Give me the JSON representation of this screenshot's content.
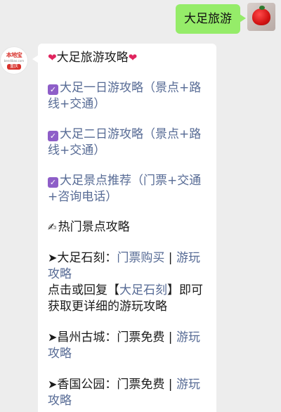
{
  "outgoing": {
    "text": "大足旅游"
  },
  "bot": {
    "brand": "本地宝",
    "site": "bendibao.com",
    "city": "重庆"
  },
  "message": {
    "title_heart_left": "❤",
    "title": "大足旅游攻略",
    "title_heart_right": "❤",
    "links": [
      {
        "check": "✓",
        "text": "大足一日游攻略（景点+路线+交通）"
      },
      {
        "check": "✓",
        "text": "大足二日游攻略（景点+路线+交通）"
      },
      {
        "check": "✓",
        "text": "大足景点推荐（门票+交通+咨询电话）"
      }
    ],
    "hot_icon": "✍",
    "hot_title": "热门景点攻略",
    "spots": [
      {
        "arrow": "➤",
        "name": "大足石刻：",
        "ticket": "门票购买",
        "sep": " | ",
        "guide": "游玩攻略",
        "note_pre": "点击或回复【",
        "note_key": "大足石刻",
        "note_post": "】即可获取更详细的游玩攻略"
      },
      {
        "arrow": "➤",
        "name": "昌州古城：",
        "ticket": "门票免费",
        "sep": " | ",
        "guide": "游玩攻略"
      },
      {
        "arrow": "➤",
        "name": "香国公园：",
        "ticket": "门票免费",
        "sep": " | ",
        "guide": "游玩攻略"
      }
    ]
  }
}
